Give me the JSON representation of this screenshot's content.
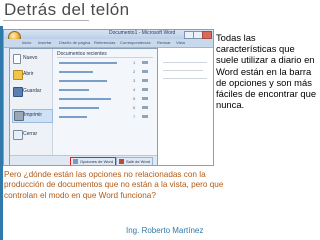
{
  "slide": {
    "title": "Detrás del telón",
    "side_text": "Todas las características que suele utilizar a diario en Word están en la barra de opciones y son más fáciles de encontrar que nunca.",
    "question": "Pero ¿dónde están las opciones no relacionadas con la producción de documentos que no están a la vista, pero que controlan el modo en que Word funciona?",
    "author": "Ing. Roberto Martínez"
  },
  "screenshot": {
    "window_title": "Documento1 - Microsoft Word",
    "ribbon_tabs": [
      "Inicio",
      "Insertar",
      "Diseño de página",
      "Referencias",
      "Correspondencia",
      "Revisar",
      "Vista"
    ],
    "menu_items": [
      "Nuevo",
      "Abrir",
      "Guardar",
      "Imprimir",
      "Cerrar"
    ],
    "recent_header": "Documentos recientes",
    "recent_numbers": [
      "1",
      "2",
      "3",
      "4",
      "5",
      "6",
      "7"
    ],
    "options_button": "Opciones de Word",
    "exit_button": "Salir de Word",
    "colors": {
      "highlight_box": "#e02020",
      "accent": "#2f7aaa"
    }
  }
}
